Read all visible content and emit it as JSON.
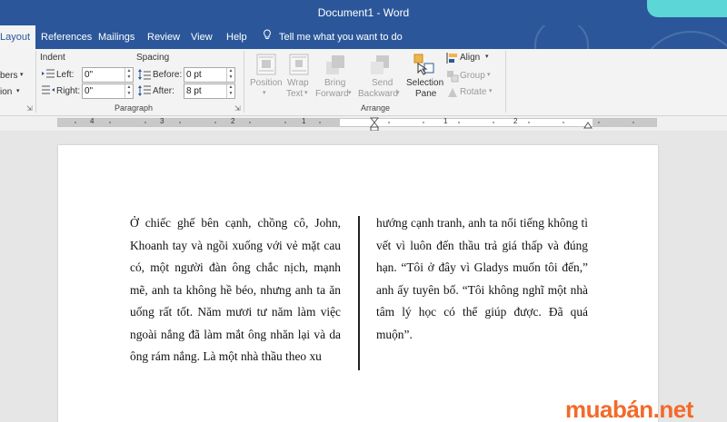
{
  "window": {
    "title": "Document1  -  Word"
  },
  "tabs": [
    {
      "label": "Layout",
      "active": true
    },
    {
      "label": "References"
    },
    {
      "label": "Mailings"
    },
    {
      "label": "Review"
    },
    {
      "label": "View"
    },
    {
      "label": "Help"
    }
  ],
  "tell_me": "Tell me what you want to do",
  "ribbon": {
    "left_cut": {
      "line1": "bers",
      "line2": "ion"
    },
    "indent": {
      "group": "Indent",
      "left_label": "Left:",
      "left_value": "0\"",
      "right_label": "Right:",
      "right_value": "0\""
    },
    "spacing": {
      "group": "Spacing",
      "before_label": "Before:",
      "before_value": "0 pt",
      "after_label": "After:",
      "after_value": "8 pt"
    },
    "paragraph_group_label": "Paragraph",
    "arrange": {
      "group_label": "Arrange",
      "position_label": "Position",
      "wrap_label1": "Wrap",
      "wrap_label2": "Text",
      "bring_label1": "Bring",
      "bring_label2": "Forward",
      "send_label1": "Send",
      "send_label2": "Backward",
      "selection_label1": "Selection",
      "selection_label2": "Pane",
      "align_label": "Align",
      "group_btn_label": "Group",
      "rotate_label": "Rotate"
    }
  },
  "ruler": {
    "left_numbers": [
      "4",
      "3",
      "2",
      "1"
    ],
    "right_numbers": [
      "1",
      "2"
    ]
  },
  "document": {
    "column1": "Ở chiếc ghế bên cạnh, chồng cô, John, Khoanh tay và ngồi xuống với vẻ mặt cau có, một người đàn ông chắc nịch, mạnh mẽ, anh ta không hề béo, nhưng anh ta ăn uống rất tốt. Năm mươi tư năm làm việc ngoài nắng đã làm mắt ông nhăn lại và da ông rám nắng. Là một nhà thầu theo xu",
    "column2": "hướng cạnh tranh, anh ta nổi tiếng không tì vết vì luôn đến thầu trả giá thấp và đúng hạn. “Tôi ở đây vì Gladys muốn tôi đến,” anh ấy tuyên bố. “Tôi không nghĩ một nhà tâm lý học có thể giúp được. Đã quá muộn”."
  },
  "watermark": "muabán.net",
  "colors": {
    "brand": "#2b579a",
    "watermark": "#f26a2a",
    "deco": "#5cd6d6"
  }
}
